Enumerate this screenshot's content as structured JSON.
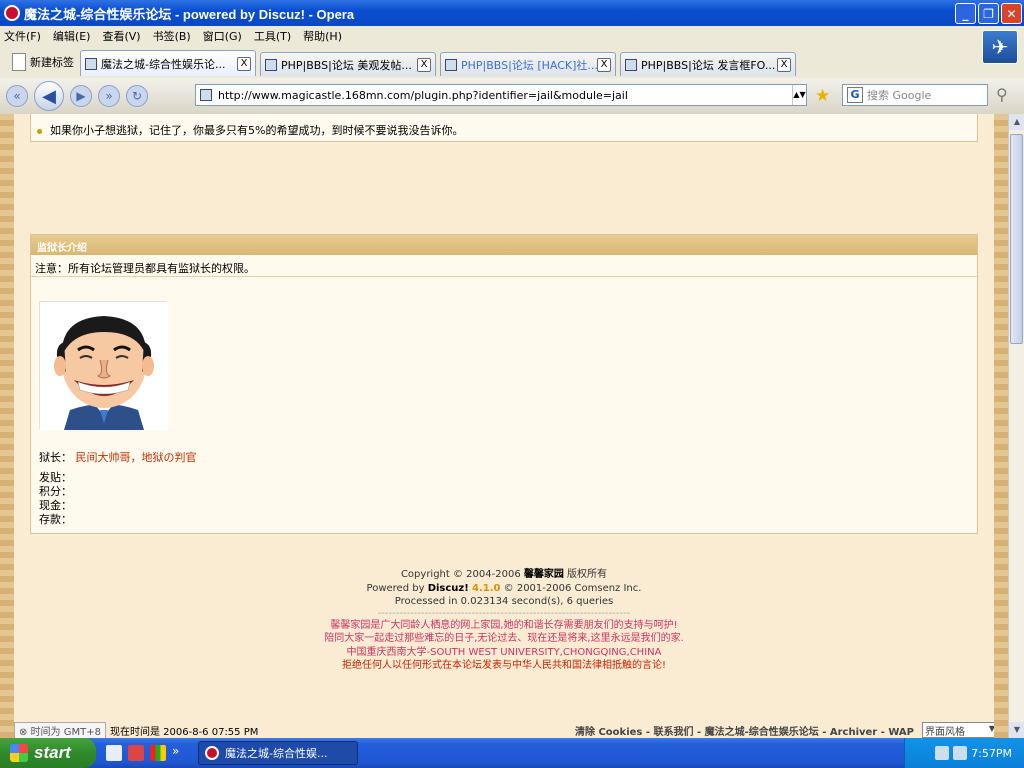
{
  "window": {
    "title": "魔法之城-综合性娱乐论坛 - powered by Discuz! - Opera"
  },
  "menu": [
    "文件(F)",
    "编辑(E)",
    "查看(V)",
    "书签(B)",
    "窗口(G)",
    "工具(T)",
    "帮助(H)"
  ],
  "tabs": {
    "new_tab": "新建标签",
    "items": [
      {
        "label": "魔法之城-综合性娱乐论...",
        "active": true
      },
      {
        "label": "PHP|BBS|论坛 美观发帖...",
        "active": false
      },
      {
        "label": "PHP|BBS|论坛 [HACK]社...",
        "active": false
      },
      {
        "label": "PHP|BBS|论坛 发言框FO...",
        "active": false
      }
    ],
    "close_glyph": "X"
  },
  "address": {
    "url": "http://www.magicastle.168mn.com/plugin.php?identifier=jail&module=jail"
  },
  "search": {
    "placeholder": "搜索 Google"
  },
  "page": {
    "notice_line": "如果你小子想逃狱，记住了，你最多只有5%的希望成功，到时候不要说我没告诉你。",
    "warden_section": {
      "title": "监狱长介绍",
      "note": "注意：所有论坛管理员都具有监狱长的权限。",
      "warden_label": "狱长：",
      "warden_name": "民间大帅哥，地狱の判官",
      "fields": [
        "发贴：",
        "积分：",
        "现金：",
        "存款："
      ]
    },
    "footer": {
      "copyright_pre": "Copyright © 2004-2006 ",
      "copyright_org": "馨馨家园",
      "copyright_post": " 版权所有",
      "powered_pre": "Powered by ",
      "powered_brand": "Discuz!",
      "powered_ver": "4.1.0",
      "powered_post": " © 2001-2006 Comsenz Inc.",
      "processed": "Processed in 0.023134 second(s), 6 queries",
      "dashes": "----------------------------------------------------------------------",
      "line1": "馨馨家园是广大同龄人栖息的网上家园,她的和谐长存需要朋友们的支持与呵护!",
      "line2": "陪同大家一起走过那些难忘的日子,无论过去、现在还是将来,这里永远是我们的家.",
      "line3": "中国重庆西南大学-SOUTH WEST UNIVERSITY,CHONGQING,CHINA",
      "line4": "拒绝任何人以任何形式在本论坛发表与中华人民共和国法律相抵触的言论!"
    },
    "bottom": {
      "status_text": "时间为 GMT+8",
      "time_text": "现在时间是 2006-8-6 07:55 PM",
      "links": "清除 Cookies - 联系我们 - 魔法之城-综合性娱乐论坛 - Archiver - WAP",
      "style_select": "界面风格"
    }
  },
  "taskbar": {
    "start": "start",
    "task_item": "魔法之城-综合性娱...",
    "clock": "7:57PM",
    "more": "»"
  }
}
